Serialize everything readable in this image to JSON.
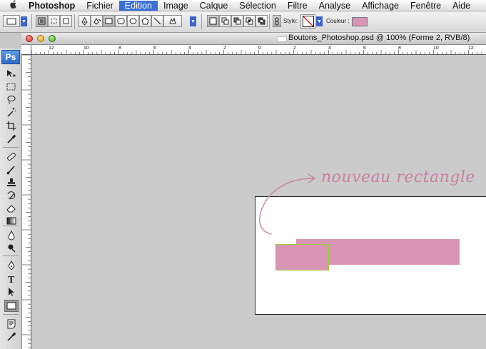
{
  "menubar": {
    "apple": "",
    "app": "Photoshop",
    "items": [
      "Fichier",
      "Edition",
      "Image",
      "Calque",
      "Sélection",
      "Filtre",
      "Analyse",
      "Affichage",
      "Fenêtre",
      "Aide"
    ]
  },
  "options": {
    "style_label": "Style:",
    "color_label": "Couleur :",
    "swatch_color": "#d894b4"
  },
  "window": {
    "title": "Boutons_Photoshop.psd @ 100% (Forme 2, RVB/8)"
  },
  "ruler_h": [
    "12",
    "10",
    "8",
    "6",
    "4",
    "2",
    "0",
    "2",
    "4",
    "6",
    "8",
    "10",
    "12"
  ],
  "ruler_v": [
    "",
    "",
    "",
    "",
    "",
    "",
    "",
    "",
    ""
  ],
  "toolbox": {
    "logo": "Ps",
    "tools": [
      "move-icon",
      "marquee-icon",
      "lasso-icon",
      "magic-wand-icon",
      "crop-icon",
      "eyedropper-icon",
      "healing-brush-icon",
      "brush-icon",
      "clone-stamp-icon",
      "history-brush-icon",
      "eraser-icon",
      "gradient-icon",
      "blur-icon",
      "dodge-icon",
      "pen-icon",
      "type-icon",
      "path-selection-icon",
      "rectangle-shape-icon",
      "notes-icon",
      "eyedropper-2-icon"
    ]
  },
  "annotation": {
    "text": "nouveau rectangle",
    "color": "#c980a4"
  },
  "colors": {
    "shape_fill": "#d894b4",
    "selection_outline": "#9acd32",
    "workspace": "#cbcbcb"
  }
}
